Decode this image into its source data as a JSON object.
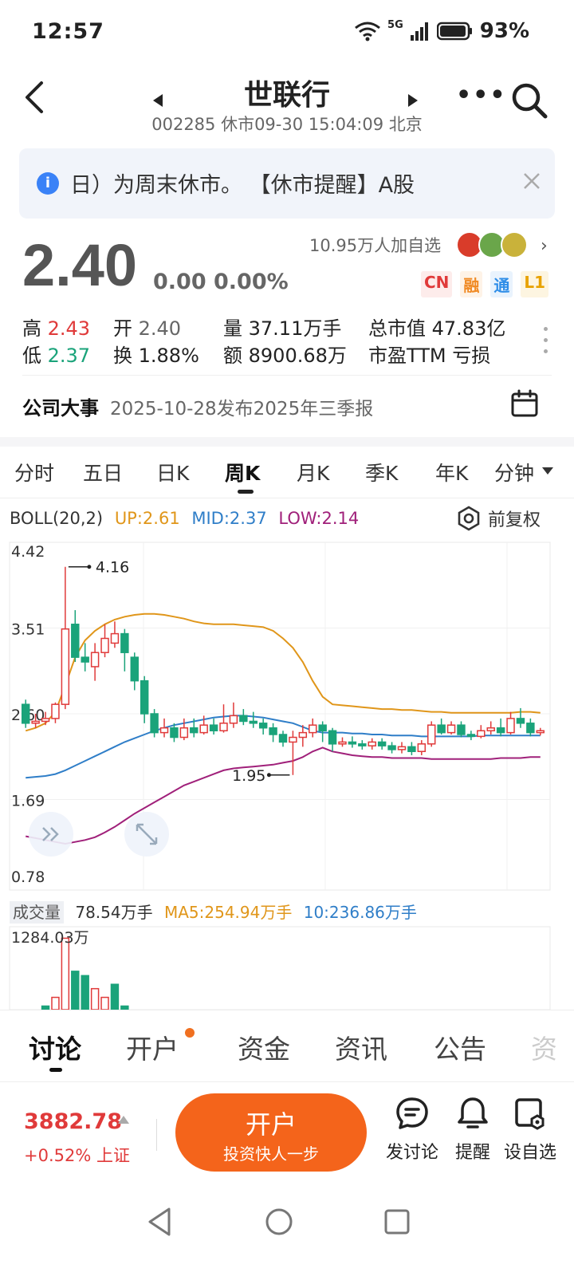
{
  "status_bar": {
    "time": "12:57",
    "network": "5G",
    "battery": "93%"
  },
  "header": {
    "title": "世联行",
    "subtitle": "002285 休市09-30 15:04:09 北京"
  },
  "notice": {
    "text": "日）为周末休市。     【休市提醒】A股"
  },
  "quote": {
    "price": "2.40",
    "change": "0.00 0.00%",
    "watchers": "10.95万人加自选",
    "tags": [
      "CN",
      "融",
      "通",
      "L1"
    ]
  },
  "stats": {
    "high_label": "高",
    "high_value": "2.43",
    "open_label": "开",
    "open_value": "2.40",
    "volume_label": "量",
    "volume_value": "37.11万手",
    "mktcap_label": "总市值",
    "mktcap_value": "47.83亿",
    "low_label": "低",
    "low_value": "2.37",
    "turnover_label": "换",
    "turnover_value": "1.88%",
    "amount_label": "额",
    "amount_value": "8900.68万",
    "pe_label": "市盈TTM",
    "pe_value": "亏损"
  },
  "event": {
    "label": "公司大事",
    "text": "2025-10-28发布2025年三季报"
  },
  "kline_tabs": [
    "分时",
    "五日",
    "日K",
    "周K",
    "月K",
    "季K",
    "年K",
    "分钟"
  ],
  "kline_active": "周K",
  "boll": {
    "name": "BOLL(20,2)",
    "up": "UP:2.61",
    "mid": "MID:2.37",
    "low": "LOW:2.14",
    "adjust": "前复权"
  },
  "chart_data": {
    "type": "candlestick",
    "y_ticks": [
      "4.42",
      "3.51",
      "2.60",
      "1.69",
      "0.78"
    ],
    "ylim": [
      0.78,
      4.42
    ],
    "annotations": {
      "max_label": "4.16",
      "min_label": "1.95"
    },
    "candles": [
      [
        2.7,
        2.5,
        2.75,
        2.45
      ],
      [
        2.5,
        2.52,
        2.6,
        2.45
      ],
      [
        2.52,
        2.55,
        2.62,
        2.48
      ],
      [
        2.55,
        2.7,
        2.72,
        2.5
      ],
      [
        2.7,
        3.5,
        4.16,
        2.65
      ],
      [
        3.55,
        3.2,
        3.7,
        3.15
      ],
      [
        3.2,
        3.15,
        3.35,
        3.05
      ],
      [
        3.1,
        3.25,
        3.35,
        2.95
      ],
      [
        3.25,
        3.4,
        3.55,
        3.2
      ],
      [
        3.35,
        3.45,
        3.58,
        3.3
      ],
      [
        3.45,
        3.25,
        3.5,
        3.05
      ],
      [
        3.2,
        2.95,
        3.25,
        2.85
      ],
      [
        2.95,
        2.6,
        3.0,
        2.5
      ],
      [
        2.6,
        2.4,
        2.65,
        2.35
      ],
      [
        2.4,
        2.45,
        2.55,
        2.35
      ],
      [
        2.45,
        2.35,
        2.5,
        2.3
      ],
      [
        2.35,
        2.45,
        2.55,
        2.32
      ],
      [
        2.45,
        2.4,
        2.55,
        2.35
      ],
      [
        2.4,
        2.48,
        2.58,
        2.38
      ],
      [
        2.48,
        2.42,
        2.55,
        2.38
      ],
      [
        2.42,
        2.5,
        2.7,
        2.4
      ],
      [
        2.5,
        2.58,
        2.72,
        2.45
      ],
      [
        2.58,
        2.52,
        2.65,
        2.48
      ],
      [
        2.52,
        2.5,
        2.62,
        2.45
      ],
      [
        2.5,
        2.45,
        2.55,
        2.38
      ],
      [
        2.45,
        2.38,
        2.5,
        2.3
      ],
      [
        2.38,
        2.3,
        2.42,
        2.25
      ],
      [
        2.3,
        2.35,
        2.42,
        1.95
      ],
      [
        2.35,
        2.4,
        2.48,
        2.25
      ],
      [
        2.4,
        2.48,
        2.55,
        2.35
      ],
      [
        2.48,
        2.42,
        2.52,
        2.3
      ],
      [
        2.42,
        2.28,
        2.45,
        2.2
      ],
      [
        2.28,
        2.3,
        2.35,
        2.25
      ],
      [
        2.3,
        2.28,
        2.36,
        2.24
      ],
      [
        2.28,
        2.26,
        2.32,
        2.22
      ],
      [
        2.26,
        2.3,
        2.34,
        2.22
      ],
      [
        2.3,
        2.26,
        2.34,
        2.22
      ],
      [
        2.26,
        2.22,
        2.3,
        2.18
      ],
      [
        2.22,
        2.25,
        2.3,
        2.18
      ],
      [
        2.25,
        2.2,
        2.3,
        2.16
      ],
      [
        2.2,
        2.28,
        2.32,
        2.16
      ],
      [
        2.28,
        2.48,
        2.52,
        2.25
      ],
      [
        2.48,
        2.4,
        2.55,
        2.38
      ],
      [
        2.4,
        2.48,
        2.52,
        2.38
      ],
      [
        2.48,
        2.38,
        2.52,
        2.35
      ],
      [
        2.38,
        2.36,
        2.42,
        2.32
      ],
      [
        2.36,
        2.42,
        2.48,
        2.34
      ],
      [
        2.42,
        2.45,
        2.52,
        2.38
      ],
      [
        2.45,
        2.4,
        2.55,
        2.36
      ],
      [
        2.4,
        2.55,
        2.62,
        2.38
      ],
      [
        2.55,
        2.5,
        2.66,
        2.45
      ],
      [
        2.5,
        2.4,
        2.55,
        2.36
      ],
      [
        2.4,
        2.42,
        2.45,
        2.37
      ]
    ],
    "up_band": [
      2.42,
      2.45,
      2.5,
      2.62,
      2.9,
      3.2,
      3.38,
      3.48,
      3.55,
      3.6,
      3.63,
      3.65,
      3.66,
      3.66,
      3.65,
      3.63,
      3.61,
      3.58,
      3.56,
      3.55,
      3.55,
      3.55,
      3.54,
      3.53,
      3.52,
      3.48,
      3.4,
      3.3,
      3.15,
      2.95,
      2.78,
      2.7,
      2.69,
      2.68,
      2.67,
      2.66,
      2.65,
      2.65,
      2.64,
      2.64,
      2.63,
      2.62,
      2.62,
      2.61,
      2.61,
      2.61,
      2.61,
      2.61,
      2.61,
      2.61,
      2.62,
      2.62,
      2.61
    ],
    "mid_band": [
      1.92,
      1.93,
      1.94,
      1.96,
      2.0,
      2.05,
      2.1,
      2.15,
      2.2,
      2.25,
      2.3,
      2.34,
      2.38,
      2.42,
      2.45,
      2.48,
      2.5,
      2.52,
      2.54,
      2.56,
      2.57,
      2.58,
      2.58,
      2.57,
      2.56,
      2.54,
      2.52,
      2.5,
      2.46,
      2.42,
      2.4,
      2.4,
      2.4,
      2.39,
      2.39,
      2.38,
      2.38,
      2.37,
      2.37,
      2.37,
      2.36,
      2.36,
      2.36,
      2.36,
      2.36,
      2.36,
      2.37,
      2.37,
      2.37,
      2.37,
      2.37,
      2.37,
      2.37
    ],
    "low_band": [
      1.3,
      1.28,
      1.26,
      1.24,
      1.22,
      1.24,
      1.26,
      1.29,
      1.34,
      1.4,
      1.47,
      1.54,
      1.6,
      1.66,
      1.72,
      1.78,
      1.84,
      1.88,
      1.92,
      1.96,
      2.0,
      2.02,
      2.03,
      2.04,
      2.05,
      2.06,
      2.08,
      2.1,
      2.14,
      2.2,
      2.24,
      2.2,
      2.18,
      2.16,
      2.15,
      2.14,
      2.14,
      2.13,
      2.13,
      2.13,
      2.13,
      2.12,
      2.12,
      2.12,
      2.12,
      2.12,
      2.12,
      2.12,
      2.13,
      2.13,
      2.13,
      2.14,
      2.14
    ]
  },
  "volume": {
    "badge": "成交量",
    "value": "78.54万手",
    "ma5": "MA5:254.94万手",
    "ma10": "10:236.86万手",
    "max_label": "1284.03万",
    "bars": [
      [
        300,
        0
      ],
      [
        450,
        1
      ],
      [
        500,
        1
      ],
      [
        600,
        0
      ],
      [
        1280,
        0
      ],
      [
        900,
        1
      ],
      [
        850,
        1
      ],
      [
        700,
        0
      ],
      [
        600,
        0
      ],
      [
        750,
        1
      ],
      [
        500,
        1
      ],
      [
        400,
        1
      ],
      [
        350,
        1
      ],
      [
        300,
        1
      ],
      [
        250,
        0
      ],
      [
        200,
        1
      ],
      [
        220,
        0
      ],
      [
        180,
        1
      ],
      [
        200,
        0
      ],
      [
        160,
        1
      ],
      [
        260,
        0
      ],
      [
        300,
        0
      ],
      [
        220,
        1
      ],
      [
        200,
        1
      ],
      [
        180,
        1
      ],
      [
        160,
        1
      ],
      [
        150,
        1
      ],
      [
        300,
        0
      ],
      [
        200,
        0
      ],
      [
        220,
        0
      ],
      [
        180,
        1
      ],
      [
        200,
        1
      ],
      [
        150,
        1
      ],
      [
        140,
        1
      ],
      [
        130,
        1
      ],
      [
        160,
        0
      ],
      [
        140,
        1
      ],
      [
        130,
        1
      ],
      [
        150,
        0
      ],
      [
        140,
        1
      ],
      [
        180,
        0
      ],
      [
        260,
        0
      ],
      [
        200,
        1
      ],
      [
        220,
        0
      ],
      [
        180,
        1
      ],
      [
        160,
        1
      ],
      [
        180,
        0
      ],
      [
        200,
        0
      ],
      [
        170,
        1
      ],
      [
        240,
        0
      ],
      [
        260,
        1
      ],
      [
        180,
        1
      ],
      [
        80,
        0
      ]
    ]
  },
  "bottom_tabs": [
    "讨论",
    "开户",
    "资金",
    "资讯",
    "公告",
    "资"
  ],
  "index": {
    "value": "3882.78",
    "change": "+0.52% 上证"
  },
  "open_account": {
    "title": "开户",
    "subtitle": "投资快人一步"
  },
  "actions": [
    "发讨论",
    "提醒",
    "设自选"
  ],
  "colors": {
    "up": "#e03a3a",
    "down": "#1aa37a",
    "boll_up": "#e0961a",
    "boll_mid": "#2f7ec8",
    "boll_low": "#a0207a",
    "accent": "#f4641b"
  }
}
